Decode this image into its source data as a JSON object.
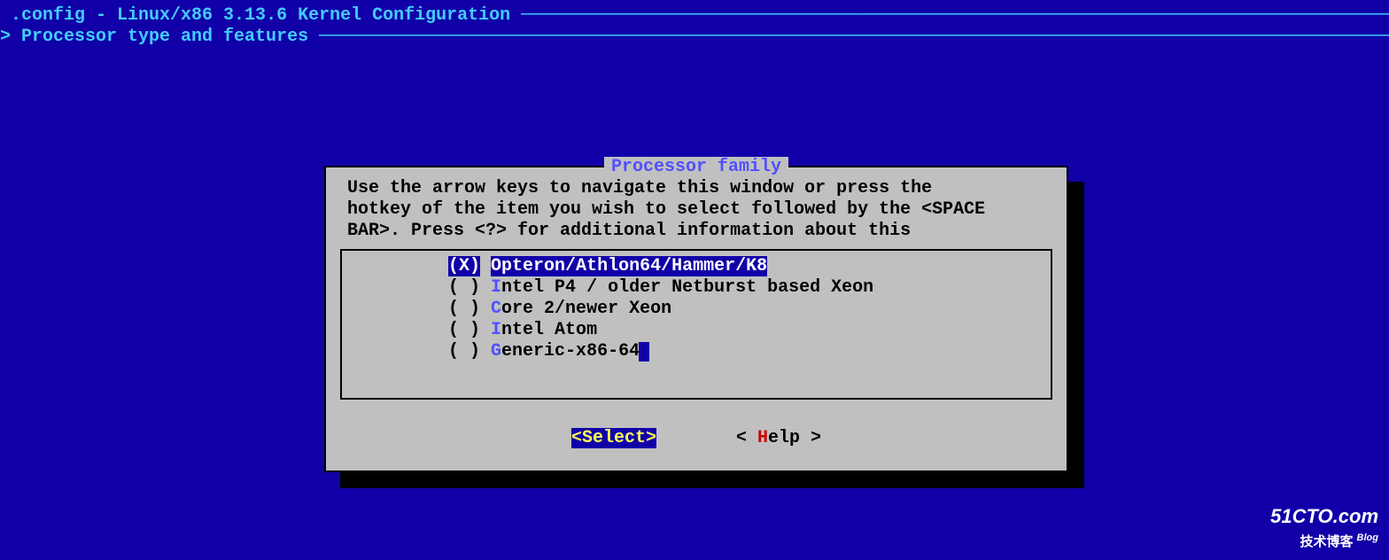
{
  "header": {
    "config_label": ".config - Linux/x86 3.13.6 Kernel Configuration",
    "breadcrumb_prefix": "> ",
    "breadcrumb_text": "Processor type and features"
  },
  "dialog": {
    "title": "Processor family",
    "help_line1": "Use the arrow keys to navigate this window or press the",
    "help_line2": "hotkey of the item you wish to select followed by the <SPACE",
    "help_line3": "BAR>. Press <?> for additional information about this",
    "options": [
      {
        "marker": "(X)",
        "hotkey": "O",
        "rest": "pteron/Athlon64/Hammer/K8",
        "selected": true
      },
      {
        "marker": "( )",
        "hotkey": "I",
        "rest": "ntel P4 / older Netburst based Xeon",
        "selected": false
      },
      {
        "marker": "( )",
        "hotkey": "C",
        "rest": "ore 2/newer Xeon",
        "selected": false
      },
      {
        "marker": "( )",
        "hotkey": "I",
        "rest": "ntel Atom",
        "selected": false
      },
      {
        "marker": "( )",
        "hotkey": "G",
        "rest": "eneric-x86-64",
        "selected": false,
        "cursor": true
      }
    ],
    "buttons": {
      "select_open": "<",
      "select_text": "Select",
      "select_close": ">",
      "help_open": "< ",
      "help_hotkey": "H",
      "help_rest": "elp >",
      "help_close": ""
    }
  },
  "watermark": {
    "line1": "51CTO.com",
    "line2": "技术博客",
    "blog": "Blog"
  }
}
